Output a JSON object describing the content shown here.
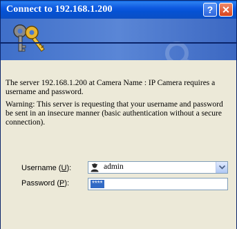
{
  "window": {
    "title": "Connect to 192.168.1.200",
    "help_glyph": "?",
    "close_glyph": "✕"
  },
  "banner": {
    "icon": "keys-icon"
  },
  "message": {
    "line1": "The server 192.168.1.200 at Camera Name : IP Camera requires a username and password.",
    "warning": "Warning: This server is requesting that your username and password be sent in an insecure manner (basic authentication without a secure connection)."
  },
  "form": {
    "username_label": "Username",
    "username_accel": "U",
    "username_suffix": "):",
    "username_value": "admin",
    "username_icon": "user-icon",
    "password_label": "Password",
    "password_accel": "P",
    "password_suffix": "):",
    "password_mask": "****"
  },
  "colors": {
    "titlebar": "#0552d4",
    "dialog_bg": "#ece9d8",
    "banner": "#4a78d0",
    "selection": "#316ac5"
  }
}
